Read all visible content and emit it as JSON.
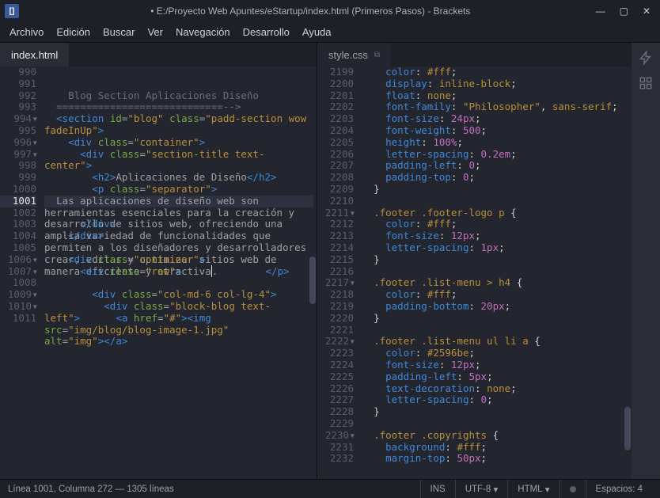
{
  "titlebar": {
    "title": "• E:/Proyecto Web Apuntes/eStartup/index.html (Primeros Pasos) - Brackets"
  },
  "menu": [
    "Archivo",
    "Edición",
    "Buscar",
    "Ver",
    "Navegación",
    "Desarrollo",
    "Ayuda"
  ],
  "tabs": {
    "left": "index.html",
    "right": "style.css"
  },
  "left_editor": {
    "start": 990,
    "lines": [
      {
        "n": 990,
        "c": ""
      },
      {
        "n": 991,
        "c": "  <!--==========================",
        "kind": "cmt"
      },
      {
        "n": 992,
        "c": "    Blog Section Aplicaciones Diseño",
        "kind": "cmt"
      },
      {
        "n": 993,
        "c": "  ============================-->",
        "kind": "cmt"
      },
      {
        "n": 994,
        "fold": true,
        "html": "  <span class='t-tag'>&lt;section</span> <span class='t-attr'>id</span>=<span class='t-str'>\"blog\"</span> <span class='t-attr'>class</span>=<span class='t-str'>\"padd-section wow   fadeInUp\"</span><span class='t-tag'>&gt;</span>"
      },
      {
        "n": 995,
        "c": ""
      },
      {
        "n": 996,
        "fold": true,
        "html": "    <span class='t-tag'>&lt;div</span> <span class='t-attr'>class</span>=<span class='t-str'>\"container\"</span><span class='t-tag'>&gt;</span>"
      },
      {
        "n": 997,
        "fold": true,
        "html": "      <span class='t-tag'>&lt;div</span> <span class='t-attr'>class</span>=<span class='t-str'>\"section-title text-       center\"</span><span class='t-tag'>&gt;</span>"
      },
      {
        "n": 998,
        "c": ""
      },
      {
        "n": 999,
        "html": "        <span class='t-tag'>&lt;h2&gt;</span><span class='t-text'>Aplicaciones de Diseño</span><span class='t-tag'>&lt;/h2&gt;</span>"
      },
      {
        "n": 1000,
        "html": "        <span class='t-tag'>&lt;p</span> <span class='t-attr'>class</span>=<span class='t-str'>\"separator\"</span><span class='t-tag'>&gt;</span>"
      },
      {
        "n": 1001,
        "active": true,
        "wrap": true,
        "html": "  <span class='t-text'>Las aplicaciones de diseño web son herramientas esenciales para la creación y desarrollo de sitios web, ofreciendo una amplia variedad de funcionalidades que permiten a los diseñadores y desarrolladores crear, editar y optimizar sitios web de manera eficiente y atractiva<span style='border-left:1px solid #ddd'></span>.</span>        <span class='t-tag'>&lt;/p&gt;</span>"
      },
      {
        "n": 1002,
        "c": ""
      },
      {
        "n": 1003,
        "html": "      <span class='t-tag'>&lt;/div&gt;</span>"
      },
      {
        "n": 1004,
        "html": "    <span class='t-tag'>&lt;/div&gt;</span>"
      },
      {
        "n": 1005,
        "c": ""
      },
      {
        "n": 1006,
        "fold": true,
        "html": "    <span class='t-tag'>&lt;div</span> <span class='t-attr'>class</span>=<span class='t-str'>\"container\"</span><span class='t-tag'>&gt;</span>"
      },
      {
        "n": 1007,
        "fold": true,
        "html": "      <span class='t-tag'>&lt;div</span> <span class='t-attr'>class</span>=<span class='t-str'>\"row\"</span><span class='t-tag'>&gt;</span>"
      },
      {
        "n": 1008,
        "c": ""
      },
      {
        "n": 1009,
        "fold": true,
        "html": "        <span class='t-tag'>&lt;div</span> <span class='t-attr'>class</span>=<span class='t-str'>\"col-md-6 col-lg-4\"</span><span class='t-tag'>&gt;</span>"
      },
      {
        "n": 1010,
        "fold": true,
        "html": "          <span class='t-tag'>&lt;div</span> <span class='t-attr'>class</span>=<span class='t-str'>\"block-blog text-           left\"</span><span class='t-tag'>&gt;</span>"
      },
      {
        "n": 1011,
        "html": "            <span class='t-tag'>&lt;a</span> <span class='t-attr'>href</span>=<span class='t-str'>\"#\"</span><span class='t-tag'>&gt;&lt;img</span>             <span class='t-attr'>src</span>=<span class='t-str'>\"img/blog/blog-image-1.jpg\"</span>             <span class='t-attr'>alt</span>=<span class='t-str'>\"img\"</span><span class='t-tag'>&gt;&lt;/a&gt;</span>"
      }
    ]
  },
  "right_editor": {
    "start": 2199,
    "lines": [
      {
        "n": 2199,
        "html": "    <span class='t-prop'>color</span><span class='t-punc'>:</span> <span class='t-val'>#fff</span><span class='t-punc'>;</span>"
      },
      {
        "n": 2200,
        "html": "    <span class='t-prop'>display</span><span class='t-punc'>:</span> <span class='t-val'>inline-block</span><span class='t-punc'>;</span>"
      },
      {
        "n": 2201,
        "html": "    <span class='t-prop'>float</span><span class='t-punc'>:</span> <span class='t-val'>none</span><span class='t-punc'>;</span>"
      },
      {
        "n": 2202,
        "html": "    <span class='t-prop'>font-family</span><span class='t-punc'>:</span> <span class='t-str'>\"Philosopher\"</span><span class='t-punc'>,</span> <span class='t-val'>sans-serif</span><span class='t-punc'>;</span>"
      },
      {
        "n": 2203,
        "html": "    <span class='t-prop'>font-size</span><span class='t-punc'>:</span> <span class='t-num'>24px</span><span class='t-punc'>;</span>"
      },
      {
        "n": 2204,
        "html": "    <span class='t-prop'>font-weight</span><span class='t-punc'>:</span> <span class='t-num'>500</span><span class='t-punc'>;</span>"
      },
      {
        "n": 2205,
        "html": "    <span class='t-prop'>height</span><span class='t-punc'>:</span> <span class='t-num'>100%</span><span class='t-punc'>;</span>"
      },
      {
        "n": 2206,
        "html": "    <span class='t-prop'>letter-spacing</span><span class='t-punc'>:</span> <span class='t-num'>0.2em</span><span class='t-punc'>;</span>"
      },
      {
        "n": 2207,
        "html": "    <span class='t-prop'>padding-left</span><span class='t-punc'>:</span> <span class='t-num'>0</span><span class='t-punc'>;</span>"
      },
      {
        "n": 2208,
        "html": "    <span class='t-prop'>padding-top</span><span class='t-punc'>:</span> <span class='t-num'>0</span><span class='t-punc'>;</span>"
      },
      {
        "n": 2209,
        "html": "  <span class='t-punc'>}</span>"
      },
      {
        "n": 2210,
        "c": ""
      },
      {
        "n": 2211,
        "fold": true,
        "html": "  <span class='t-sel'>.footer .footer-logo p</span> <span class='t-punc'>{</span>"
      },
      {
        "n": 2212,
        "html": "    <span class='t-prop'>color</span><span class='t-punc'>:</span> <span class='t-val'>#fff</span><span class='t-punc'>;</span>"
      },
      {
        "n": 2213,
        "html": "    <span class='t-prop'>font-size</span><span class='t-punc'>:</span> <span class='t-num'>12px</span><span class='t-punc'>;</span>"
      },
      {
        "n": 2214,
        "html": "    <span class='t-prop'>letter-spacing</span><span class='t-punc'>:</span> <span class='t-num'>1px</span><span class='t-punc'>;</span>"
      },
      {
        "n": 2215,
        "html": "  <span class='t-punc'>}</span>"
      },
      {
        "n": 2216,
        "c": ""
      },
      {
        "n": 2217,
        "fold": true,
        "html": "  <span class='t-sel'>.footer .list-menu &gt; h4</span> <span class='t-punc'>{</span>"
      },
      {
        "n": 2218,
        "html": "    <span class='t-prop'>color</span><span class='t-punc'>:</span> <span class='t-val'>#fff</span><span class='t-punc'>;</span>"
      },
      {
        "n": 2219,
        "html": "    <span class='t-prop'>padding-bottom</span><span class='t-punc'>:</span> <span class='t-num'>20px</span><span class='t-punc'>;</span>"
      },
      {
        "n": 2220,
        "html": "  <span class='t-punc'>}</span>"
      },
      {
        "n": 2221,
        "c": ""
      },
      {
        "n": 2222,
        "fold": true,
        "html": "  <span class='t-sel'>.footer .list-menu ul li a</span> <span class='t-punc'>{</span>"
      },
      {
        "n": 2223,
        "html": "    <span class='t-prop'>color</span><span class='t-punc'>:</span> <span class='t-val'>#2596be</span><span class='t-punc'>;</span>"
      },
      {
        "n": 2224,
        "html": "    <span class='t-prop'>font-size</span><span class='t-punc'>:</span> <span class='t-num'>12px</span><span class='t-punc'>;</span>"
      },
      {
        "n": 2225,
        "html": "    <span class='t-prop'>padding-left</span><span class='t-punc'>:</span> <span class='t-num'>5px</span><span class='t-punc'>;</span>"
      },
      {
        "n": 2226,
        "html": "    <span class='t-prop'>text-decoration</span><span class='t-punc'>:</span> <span class='t-val'>none</span><span class='t-punc'>;</span>"
      },
      {
        "n": 2227,
        "html": "    <span class='t-prop'>letter-spacing</span><span class='t-punc'>:</span> <span class='t-num'>0</span><span class='t-punc'>;</span>"
      },
      {
        "n": 2228,
        "html": "  <span class='t-punc'>}</span>"
      },
      {
        "n": 2229,
        "c": ""
      },
      {
        "n": 2230,
        "fold": true,
        "html": "  <span class='t-sel'>.footer .copyrights</span> <span class='t-punc'>{</span>"
      },
      {
        "n": 2231,
        "html": "    <span class='t-prop'>background</span><span class='t-punc'>:</span> <span class='t-val'>#fff</span><span class='t-punc'>;</span>"
      },
      {
        "n": 2232,
        "html": "    <span class='t-prop'>margin-top</span><span class='t-punc'>:</span> <span class='t-num'>50px</span><span class='t-punc'>;</span>"
      }
    ]
  },
  "statusbar": {
    "cursor": "Línea 1001, Columna 272 — 1305 líneas",
    "ins": "INS",
    "enc": "UTF-8",
    "lang": "HTML",
    "spaces": "Espacios: 4"
  }
}
